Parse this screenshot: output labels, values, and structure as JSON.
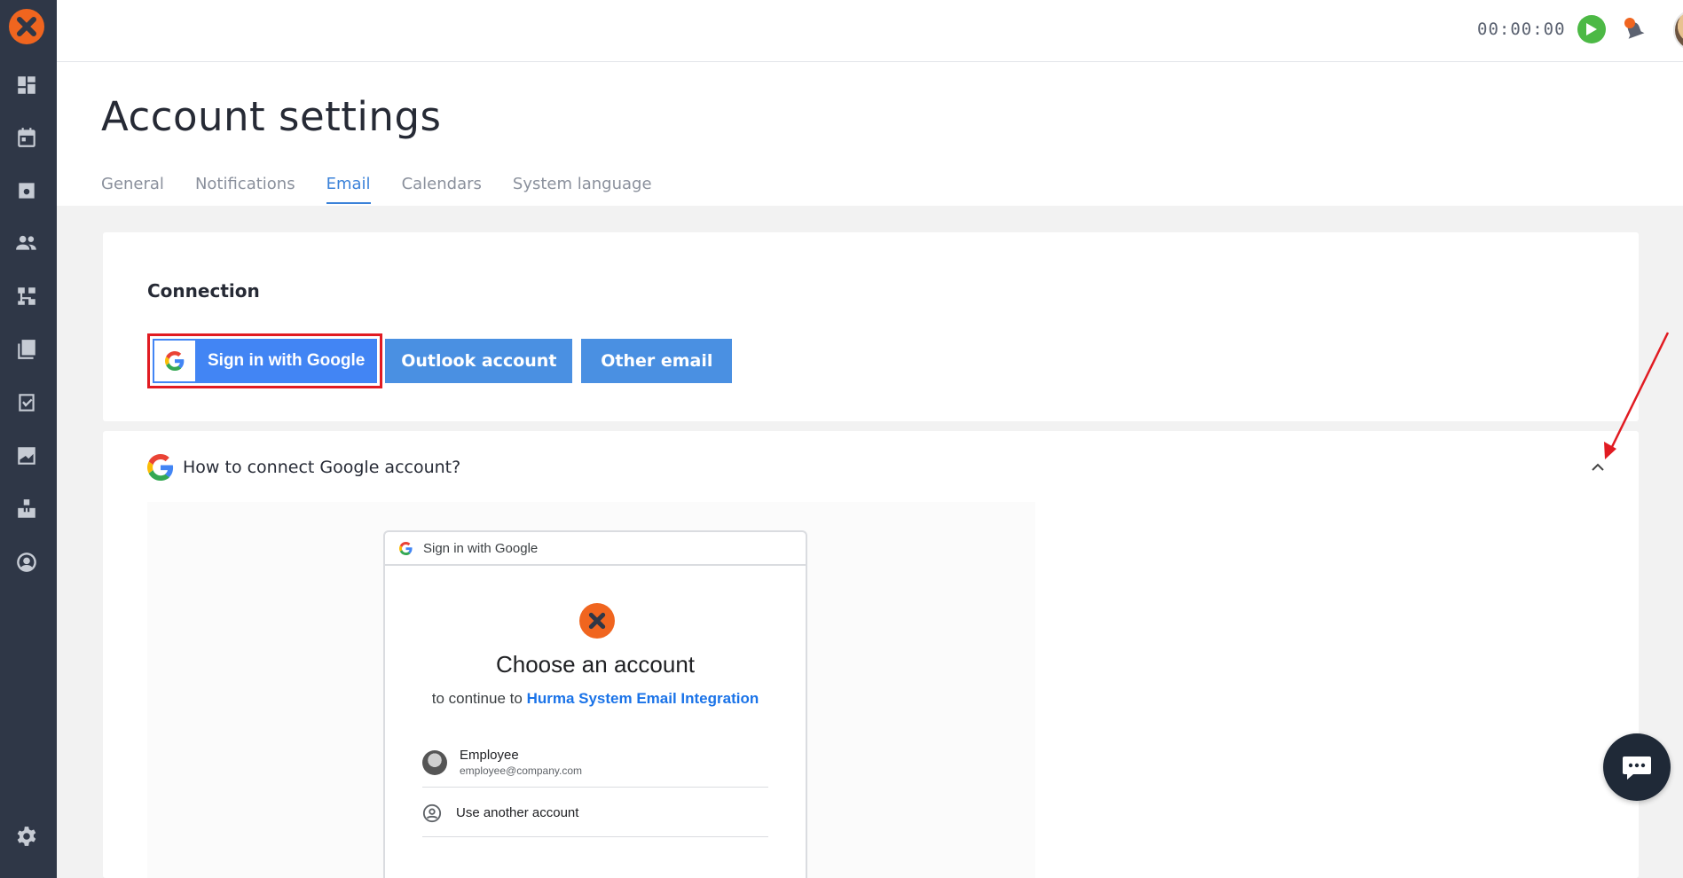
{
  "topbar": {
    "timer": "00:00:00"
  },
  "header": {
    "title": "Account settings",
    "tabs": [
      {
        "label": "General"
      },
      {
        "label": "Notifications"
      },
      {
        "label": "Email",
        "active": true
      },
      {
        "label": "Calendars"
      },
      {
        "label": "System language"
      }
    ]
  },
  "connection": {
    "title": "Connection",
    "google_label": "Sign in with Google",
    "outlook_label": "Outlook account",
    "other_label": "Other email"
  },
  "help": {
    "title": "How to connect Google account?",
    "preview": {
      "header": "Sign in with Google",
      "title": "Choose an account",
      "sub_prefix": "to continue to",
      "sub_app": "Hurma System Email Integration",
      "account_name": "Employee",
      "account_email": "employee@company.com",
      "another": "Use another account"
    }
  },
  "icons": [
    "dashboard-icon",
    "calendar-icon",
    "contacts-icon",
    "people-icon",
    "structure-icon",
    "library-icon",
    "tasks-icon",
    "reports-icon",
    "assets-icon",
    "profile-icon",
    "settings-icon"
  ],
  "colors": {
    "sidebar": "#2f3747",
    "accent": "#4a90e2",
    "google_blue": "#4285f4",
    "brand_orange": "#f0651f",
    "highlight_red": "#e11b22"
  }
}
